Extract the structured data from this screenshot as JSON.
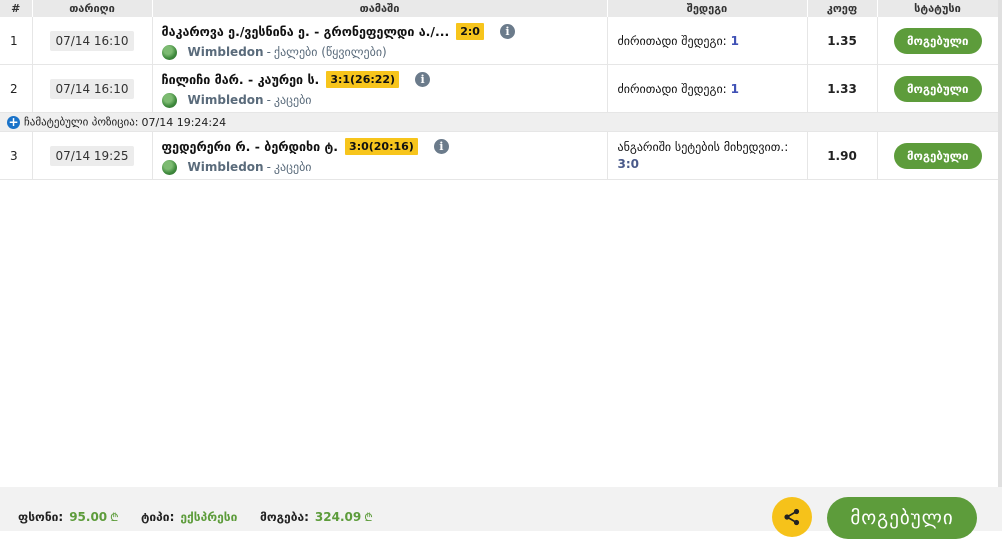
{
  "table": {
    "headers": [
      "#",
      "თარიღი",
      "თამაში",
      "შედეგი",
      "კოეფ",
      "სტატუსი"
    ],
    "rows": [
      {
        "num": "1",
        "date": "07/14 16:10",
        "match": "მაკაროვა ე./ვესნინა ე. - გრონეფელდი ა./...",
        "score": "2:0",
        "tournament": "Wimbledon",
        "category": "ქალები (წყვილები)",
        "result_label": "ძირითადი შედეგი:",
        "result_value": "1",
        "coef": "1.35",
        "status": "მოგებული"
      },
      {
        "num": "2",
        "date": "07/14 16:10",
        "match": "ჩილიჩი მარ. - კაურეი ს.",
        "score": "3:1(26:22)",
        "tournament": "Wimbledon",
        "category": "კაცები",
        "result_label": "ძირითადი შედეგი:",
        "result_value": "1",
        "coef": "1.33",
        "status": "მოგებული"
      },
      {
        "num": "3",
        "date": "07/14 19:25",
        "match": "ფედერერი რ. - ბერდიხი ტ.",
        "score": "3:0(20:16)",
        "tournament": "Wimbledon",
        "category": "კაცები",
        "result_label": "ანგარიში სეტების მიხედვით.:",
        "result_value": "3:0",
        "coef": "1.90",
        "status": "მოგებული"
      }
    ],
    "calc_row": {
      "label": "ჩამატებული პოზიცია:",
      "time": "07/14 19:24:24"
    }
  },
  "footer": {
    "stake_label": "ფსონი:",
    "stake_value": "95.00",
    "type_label": "ტიპი:",
    "type_value": "ექსპრესი",
    "win_label": "მოგება:",
    "win_value": "324.09",
    "currency": "₾",
    "status": "მოგებული"
  },
  "icons": {
    "info": "info-icon",
    "sport": "tennis-ball-icon",
    "add": "plus-circle-icon",
    "share": "share-icon"
  },
  "colors": {
    "win_green": "#5d9c3b",
    "score_yellow": "#f7c51c",
    "share_yellow": "#f6c21a",
    "link_blue": "#1a73c9"
  }
}
